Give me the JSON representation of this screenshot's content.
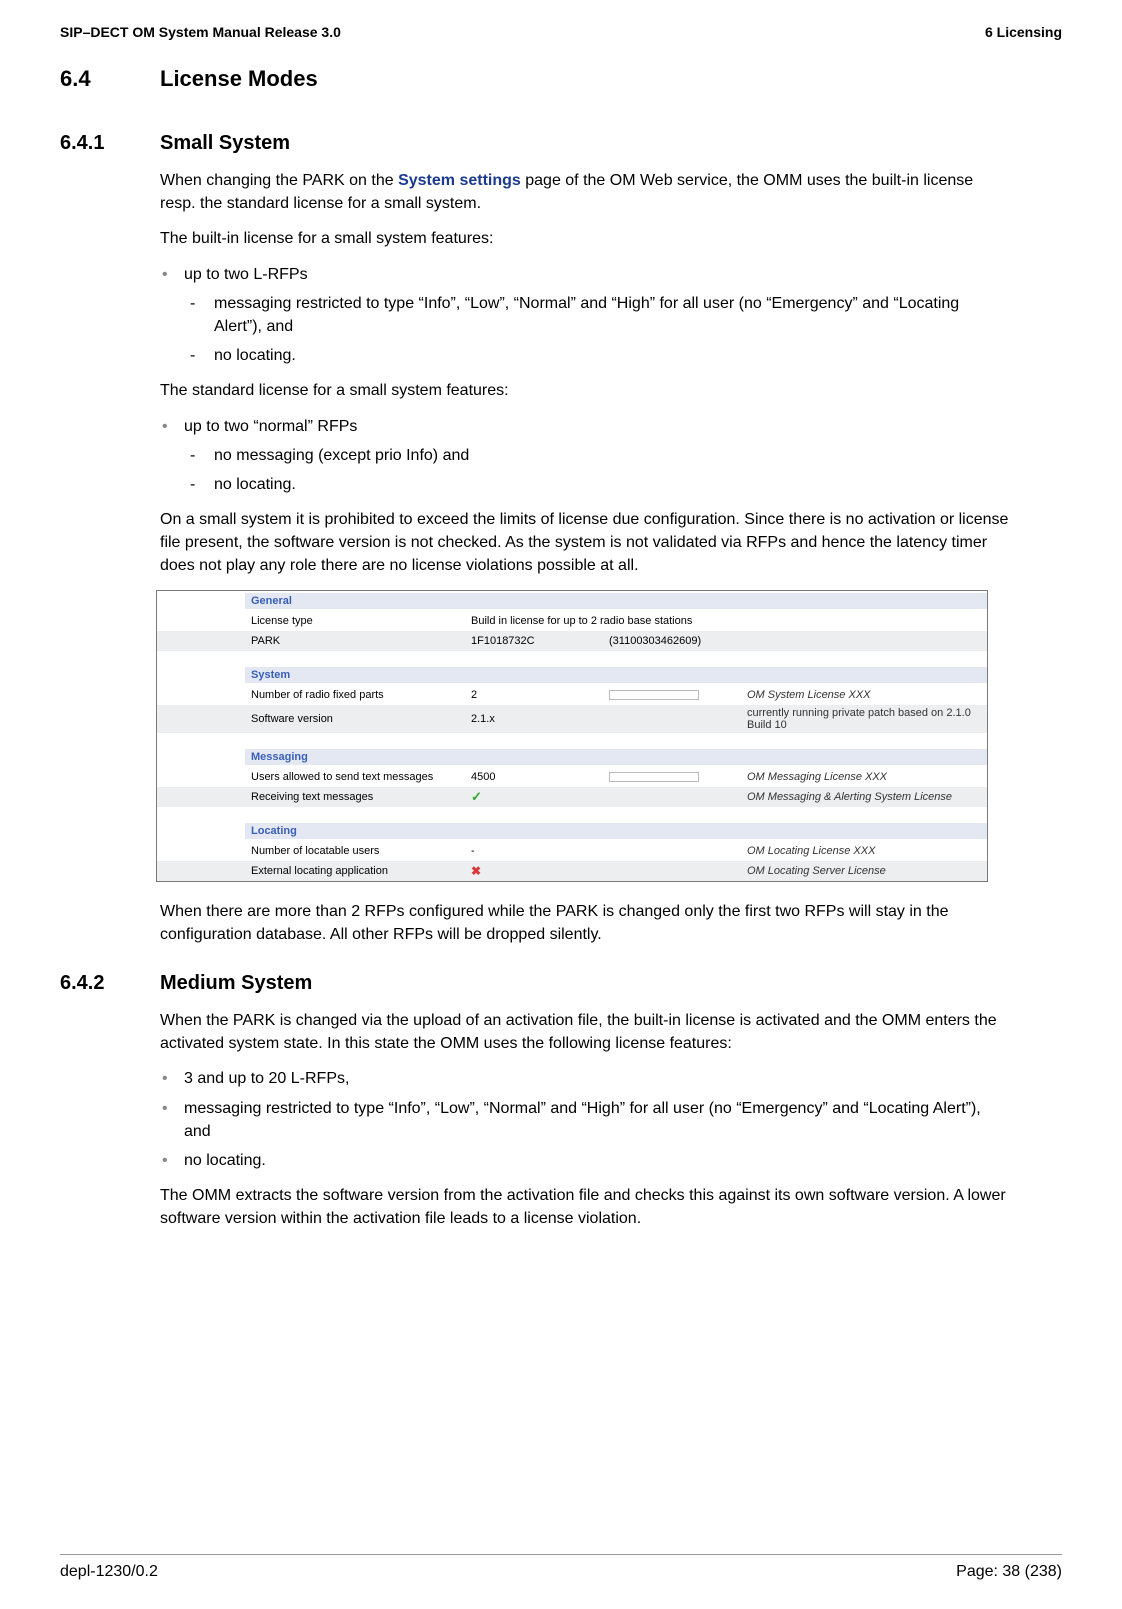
{
  "header": {
    "left": "SIP–DECT OM System Manual Release 3.0",
    "right": "6 Licensing"
  },
  "s64": {
    "num": "6.4",
    "title": "License Modes"
  },
  "s641": {
    "num": "6.4.1",
    "title": "Small System",
    "p1a": "When changing the PARK on the ",
    "p1link": "System settings",
    "p1b": " page of the OM Web service, the OMM uses the built-in license resp. the standard license for a small system.",
    "p2": "The built-in license for a small system features:",
    "b1": "up to two L-RFPs",
    "b1s1": "messaging restricted to type “Info”, “Low”, “Normal” and “High” for all user (no “Emergency” and “Locating Alert”), and",
    "b1s2": "no locating.",
    "p3": "The standard license for a small system features:",
    "b2": "up to two “normal” RFPs",
    "b2s1": "no messaging (except prio Info) and",
    "b2s2": "no locating.",
    "p4": "On a small system it is prohibited to exceed the limits of license due configuration. Since there is no activation or license file present, the software version is not checked. As the system is not validated via RFPs and hence the latency timer does not play any role there are no license violations possible at all.",
    "p5": "When there are more than 2 RFPs configured while the PARK is changed only the first two RFPs will stay in the configuration database. All other RFPs will be dropped silently."
  },
  "tbl": {
    "general": "General",
    "r1l": "License type",
    "r1v": "Build in license for up to 2 radio base stations",
    "r2l": "PARK",
    "r2v": "1F1018732C",
    "r2v2": "(31100303462609)",
    "system": "System",
    "r3l": "Number of radio fixed parts",
    "r3v": "2",
    "r3n": "OM System License XXX",
    "r4l": "Software version",
    "r4v": "2.1.x",
    "r4n": "currently running private patch based on 2.1.0 Build 10",
    "messaging": "Messaging",
    "r5l": "Users allowed to send text messages",
    "r5v": "4500",
    "r5n": "OM Messaging License XXX",
    "r6l": "Receiving text messages",
    "r6n": "OM Messaging & Alerting System License",
    "locating": "Locating",
    "r7l": "Number of locatable users",
    "r7v": "-",
    "r7n": "OM Locating License XXX",
    "r8l": "External locating application",
    "r8n": "OM Locating Server License"
  },
  "s642": {
    "num": "6.4.2",
    "title": "Medium System",
    "p1": "When the PARK is changed via the upload of an activation file, the built-in license is activated and the OMM enters the activated system state. In this state the OMM uses the following license features:",
    "b1": "3 and up to 20 L-RFPs,",
    "b2": "messaging restricted to type “Info”, “Low”, “Normal” and “High” for all user (no “Emergency” and “Locating Alert”), and",
    "b3": "no locating.",
    "p2": "The OMM extracts the software version from the activation file and checks this against its own software version. A lower software version within the activation file leads to a license violation."
  },
  "footer": {
    "left": "depl-1230/0.2",
    "right": "Page: 38 (238)"
  }
}
